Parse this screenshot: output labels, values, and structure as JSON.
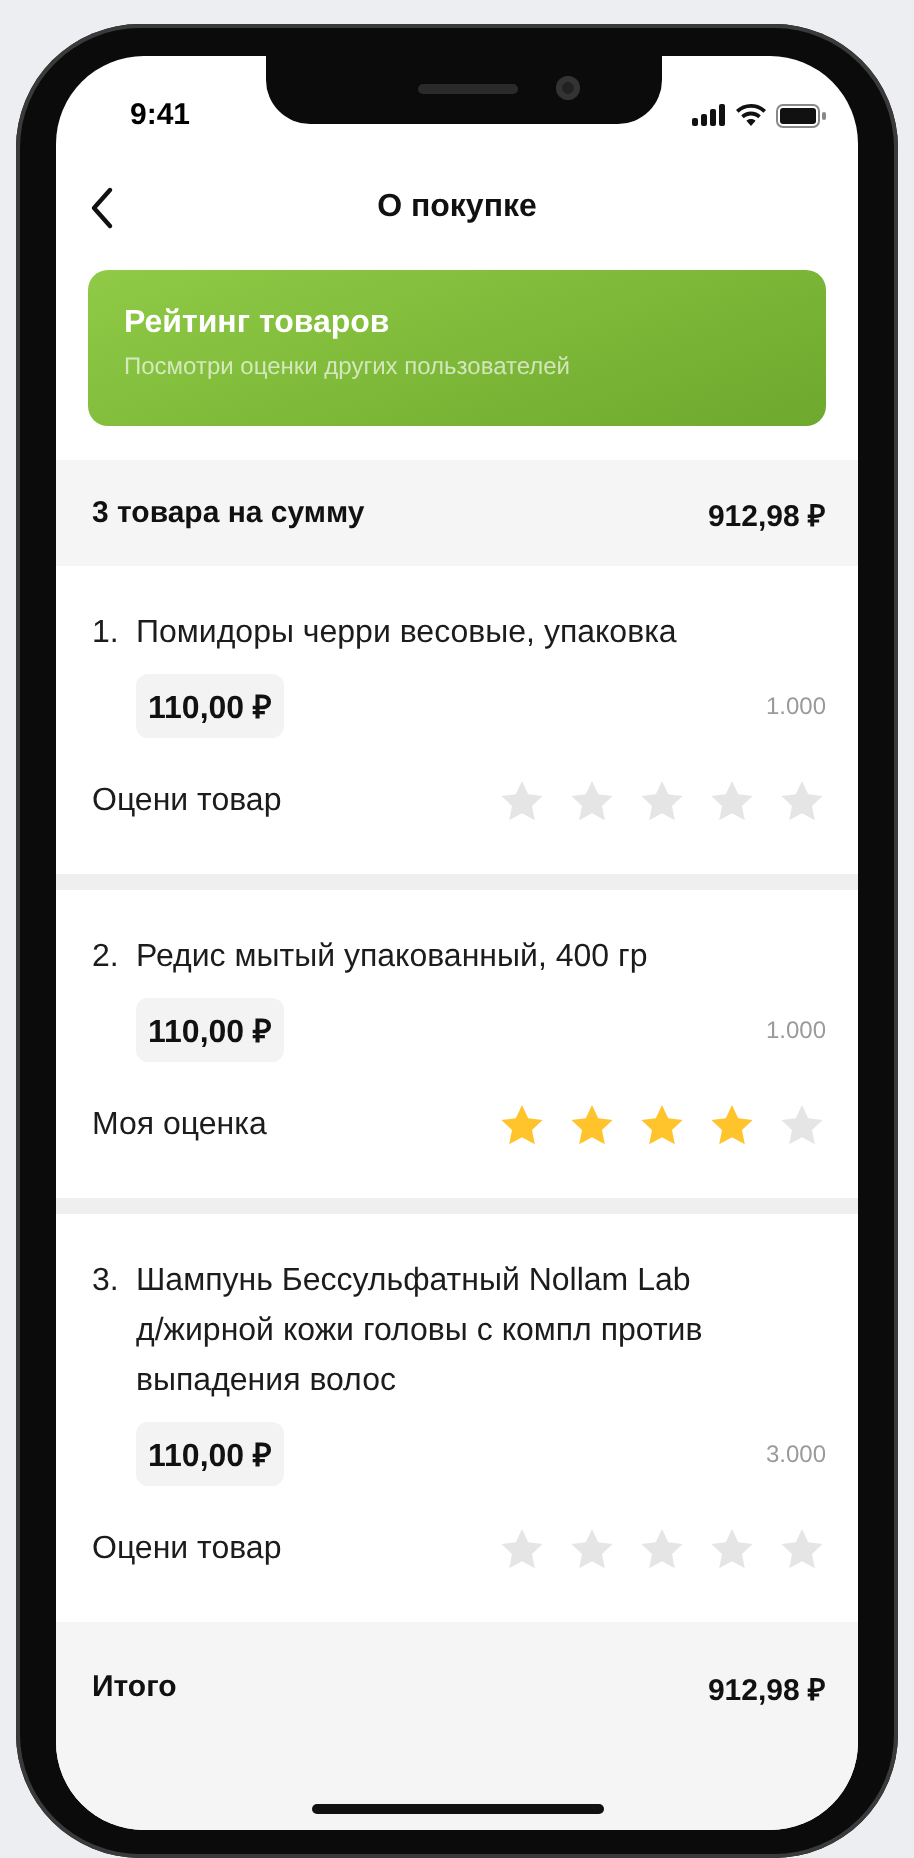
{
  "status_bar": {
    "time": "9:41"
  },
  "header": {
    "title": "О покупке"
  },
  "banner": {
    "title": "Рейтинг товаров",
    "subtitle": "Посмотри оценки других пользователей"
  },
  "summary": {
    "label": "3 товара на сумму",
    "amount": "912,98 ₽"
  },
  "items": [
    {
      "number": "1.",
      "name": "Помидоры черри весовые, упаковка",
      "price": "110,00 ₽",
      "quantity": "1.000",
      "rating_label": "Оцени товар",
      "stars": 0
    },
    {
      "number": "2.",
      "name": "Редис мытый упакованный, 400 гр",
      "price": "110,00 ₽",
      "quantity": "1.000",
      "rating_label": "Моя оценка",
      "stars": 4
    },
    {
      "number": "3.",
      "name": "Шампунь Бессульфатный Nollam Lab д/жирной кожи головы с компл против выпадения волос",
      "price": "110,00 ₽",
      "quantity": "3.000",
      "rating_label": "Оцени товар",
      "stars": 0
    }
  ],
  "total": {
    "label": "Итого",
    "amount": "912,98 ₽"
  }
}
